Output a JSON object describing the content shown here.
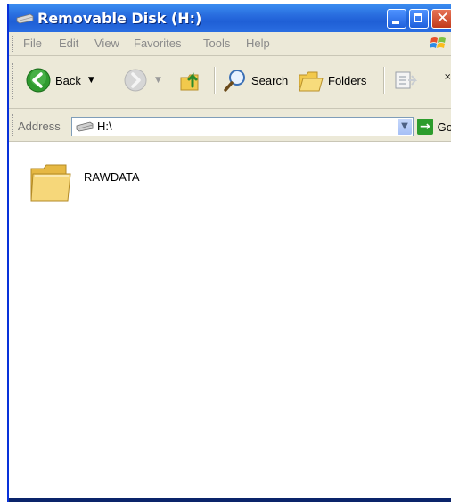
{
  "window": {
    "title": "Removable Disk (H:)"
  },
  "menu": {
    "items": [
      "File",
      "Edit",
      "View",
      "Favorites",
      "Tools",
      "Help"
    ]
  },
  "toolbar": {
    "back_label": "Back",
    "search_label": "Search",
    "folders_label": "Folders"
  },
  "address": {
    "label": "Address",
    "value": "H:\\",
    "go_label": "Go"
  },
  "content": {
    "items": [
      {
        "name": "RAWDATA",
        "type": "folder"
      }
    ]
  },
  "colors": {
    "titlebar": "#2a6fe0",
    "chrome": "#ece9d8",
    "close_button": "#c23a1a",
    "back_green": "#2c9c2c",
    "folder_yellow": "#f6d77a"
  },
  "icons": {
    "title": "drive-icon",
    "back": "back-arrow-icon",
    "forward": "forward-arrow-icon",
    "up": "folder-up-icon",
    "search": "search-icon",
    "folders": "folders-icon",
    "views": "views-icon",
    "go": "go-arrow-icon",
    "folder": "folder-icon"
  }
}
